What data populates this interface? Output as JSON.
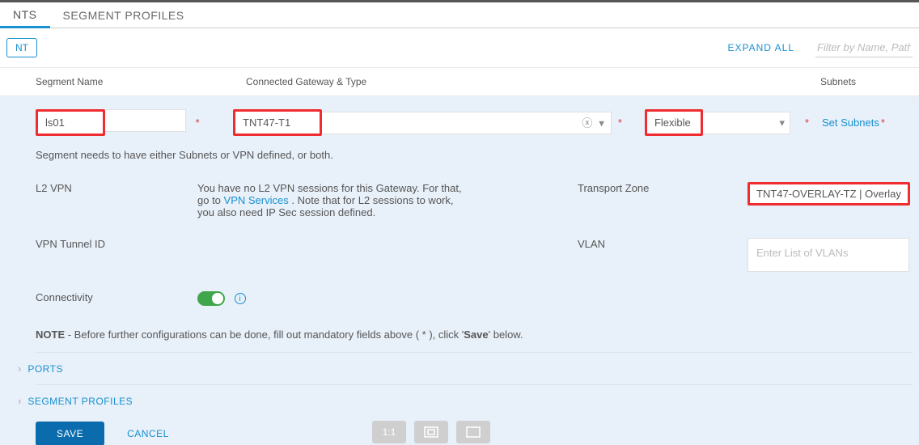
{
  "tabs": {
    "segments": "NTS",
    "profiles": "SEGMENT PROFILES"
  },
  "toolbar": {
    "add_btn": "NT",
    "expand_all": "EXPAND ALL",
    "filter_placeholder": "Filter by Name, Path o"
  },
  "headers": {
    "segment_name": "Segment Name",
    "connected_gw": "Connected Gateway & Type",
    "subnets": "Subnets"
  },
  "form": {
    "segment_name_value": "ls01",
    "gateway_value": "TNT47-T1",
    "type_value": "Flexible",
    "set_subnets_label": "Set Subnets"
  },
  "hint": "Segment needs to have either Subnets or VPN defined, or both.",
  "labels": {
    "l2vpn": "L2 VPN",
    "l2vpn_text_1": "You have no L2 VPN sessions for this Gateway. For that,",
    "l2vpn_text_2a": "go to ",
    "l2vpn_link": "VPN Services",
    "l2vpn_text_2b": " . Note that for L2 sessions to work,",
    "l2vpn_text_3": "you also need IP Sec session defined.",
    "transport_zone": "Transport Zone",
    "transport_zone_value": "TNT47-OVERLAY-TZ | Overlay",
    "vpn_tunnel": "VPN Tunnel ID",
    "vlan": "VLAN",
    "vlan_placeholder": "Enter List of VLANs",
    "connectivity": "Connectivity"
  },
  "note": {
    "prefix": "NOTE",
    "text1": " - Before further configurations can be done, fill out mandatory fields above ( * ), click '",
    "save_word": "Save",
    "text2": "' below."
  },
  "accordion": {
    "ports": "PORTS",
    "segment_profiles": "SEGMENT PROFILES"
  },
  "footer": {
    "save": "SAVE",
    "cancel": "CANCEL"
  },
  "bottom_icons": {
    "one": "1:1"
  }
}
